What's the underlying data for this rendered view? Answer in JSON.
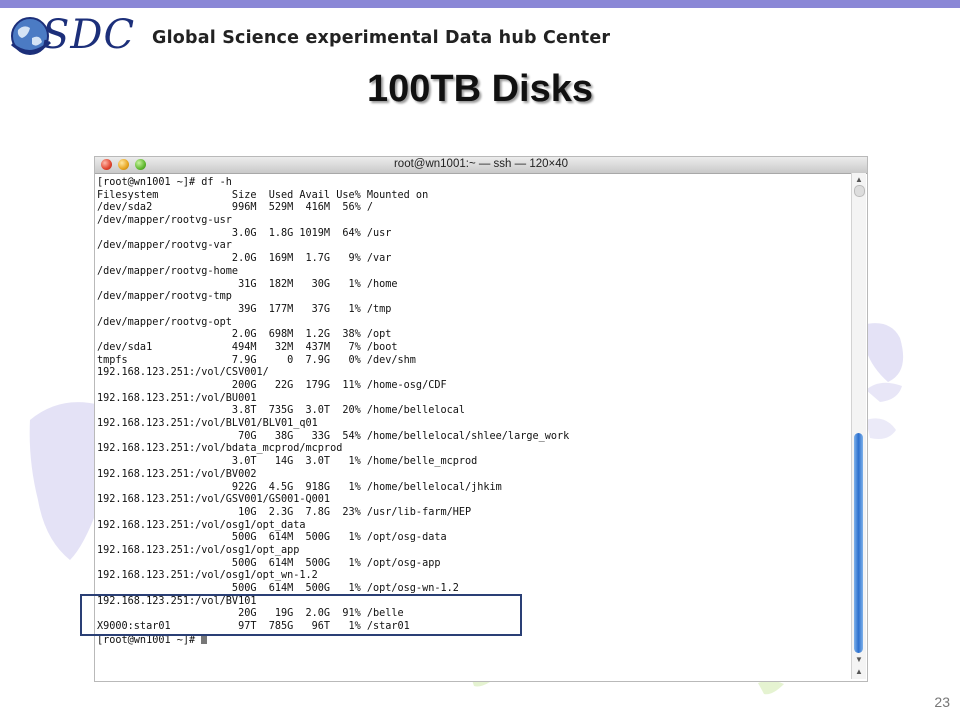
{
  "logo": {
    "text": "SDC",
    "tagline": "Global Science experimental Data hub Center"
  },
  "slide": {
    "title": "100TB Disks",
    "page_number": "23"
  },
  "terminal": {
    "window_title": "root@wn1001:~ — ssh — 120×40",
    "lines": [
      "[root@wn1001 ~]# df -h",
      "Filesystem            Size  Used Avail Use% Mounted on",
      "/dev/sda2             996M  529M  416M  56% /",
      "/dev/mapper/rootvg-usr",
      "                      3.0G  1.8G 1019M  64% /usr",
      "/dev/mapper/rootvg-var",
      "                      2.0G  169M  1.7G   9% /var",
      "/dev/mapper/rootvg-home",
      "                       31G  182M   30G   1% /home",
      "/dev/mapper/rootvg-tmp",
      "                       39G  177M   37G   1% /tmp",
      "/dev/mapper/rootvg-opt",
      "                      2.0G  698M  1.2G  38% /opt",
      "/dev/sda1             494M   32M  437M   7% /boot",
      "tmpfs                 7.9G     0  7.9G   0% /dev/shm",
      "192.168.123.251:/vol/CSV001/",
      "                      200G   22G  179G  11% /home-osg/CDF",
      "192.168.123.251:/vol/BU001",
      "                      3.8T  735G  3.0T  20% /home/bellelocal",
      "192.168.123.251:/vol/BLV01/BLV01_q01",
      "                       70G   38G   33G  54% /home/bellelocal/shlee/large_work",
      "192.168.123.251:/vol/bdata_mcprod/mcprod",
      "                      3.0T   14G  3.0T   1% /home/belle_mcprod",
      "192.168.123.251:/vol/BV002",
      "                      922G  4.5G  918G   1% /home/bellelocal/jhkim",
      "192.168.123.251:/vol/GSV001/GS001-Q001",
      "                       10G  2.3G  7.8G  23% /usr/lib-farm/HEP",
      "192.168.123.251:/vol/osg1/opt_data",
      "                      500G  614M  500G   1% /opt/osg-data",
      "192.168.123.251:/vol/osg1/opt_app",
      "                      500G  614M  500G   1% /opt/osg-app",
      "192.168.123.251:/vol/osg1/opt_wn-1.2",
      "                      500G  614M  500G   1% /opt/osg-wn-1.2",
      "192.168.123.251:/vol/BV101",
      "                       20G   19G  2.0G  91% /belle",
      "X9000:star01           97T  785G   96T   1% /star01",
      "[root@wn1001 ~]# "
    ]
  },
  "colors": {
    "topbar": "#8a87d6",
    "highlight_border": "#2a3f75",
    "scroll_thumb": "#2c6fce"
  }
}
